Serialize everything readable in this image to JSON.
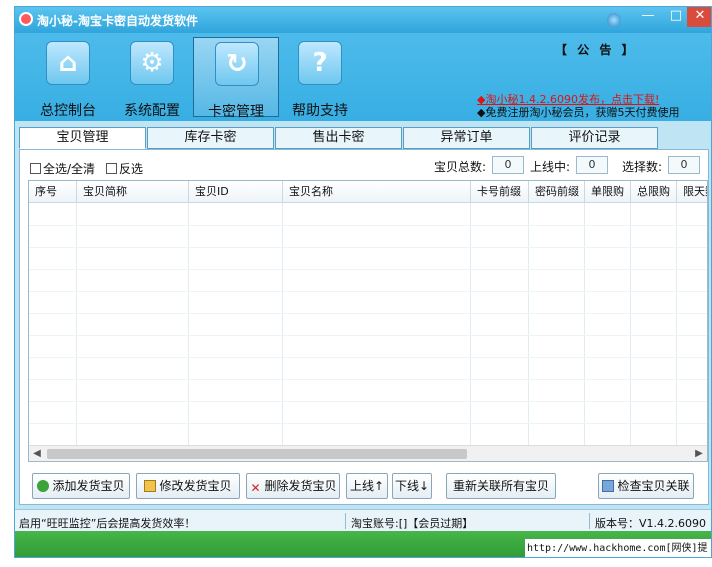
{
  "window": {
    "title": "淘小秘-淘宝卡密自动发货软件",
    "controls": {
      "min": "—",
      "max": "□",
      "close": "✕"
    }
  },
  "nav": [
    {
      "label": "总控制台",
      "icon": "home-icon",
      "glyph": "⌂"
    },
    {
      "label": "系统配置",
      "icon": "gear-icon",
      "glyph": "⚙"
    },
    {
      "label": "卡密管理",
      "icon": "refresh-icon",
      "glyph": "↻",
      "active": true
    },
    {
      "label": "帮助支持",
      "icon": "help-icon",
      "glyph": "?"
    }
  ],
  "notice": {
    "title": "【 公 告 】",
    "line1": "◆淘小秘1.4.2.6090发布，点击下载!",
    "line2": "◆免费注册淘小秘会员，获赠5天付费使用"
  },
  "tabs": [
    {
      "label": "宝贝管理",
      "active": true
    },
    {
      "label": "库存卡密"
    },
    {
      "label": "售出卡密"
    },
    {
      "label": "异常订单"
    },
    {
      "label": "评价记录"
    }
  ],
  "filters": {
    "select_all": "全选/全清",
    "invert": "反选"
  },
  "stats": {
    "total_label": "宝贝总数:",
    "total_value": "0",
    "online_label": "上线中:",
    "online_value": "0",
    "selected_label": "选择数:",
    "selected_value": "0"
  },
  "table": {
    "columns": [
      "序号",
      "宝贝简称",
      "宝贝ID",
      "宝贝名称",
      "卡号前缀",
      "密码前缀",
      "单限购",
      "总限购",
      "限天数"
    ]
  },
  "buttons": {
    "add": "添加发货宝贝",
    "edit": "修改发货宝贝",
    "delete": "删除发货宝贝",
    "online": "上线↑",
    "offline": "下线↓",
    "relink": "重新关联所有宝贝",
    "check": "检查宝贝关联"
  },
  "status": {
    "tip": "启用“旺旺监控”后会提高发货效率！",
    "account": "淘宝账号:[]【会员过期】",
    "version": "版本号：V1.4.2.6090"
  },
  "watermark": "http://www.hackhome.com[网侠]提供",
  "colors": {
    "accent": "#37aee3",
    "notice_red": "#e01212",
    "bottom_green": "#2f9a35"
  }
}
